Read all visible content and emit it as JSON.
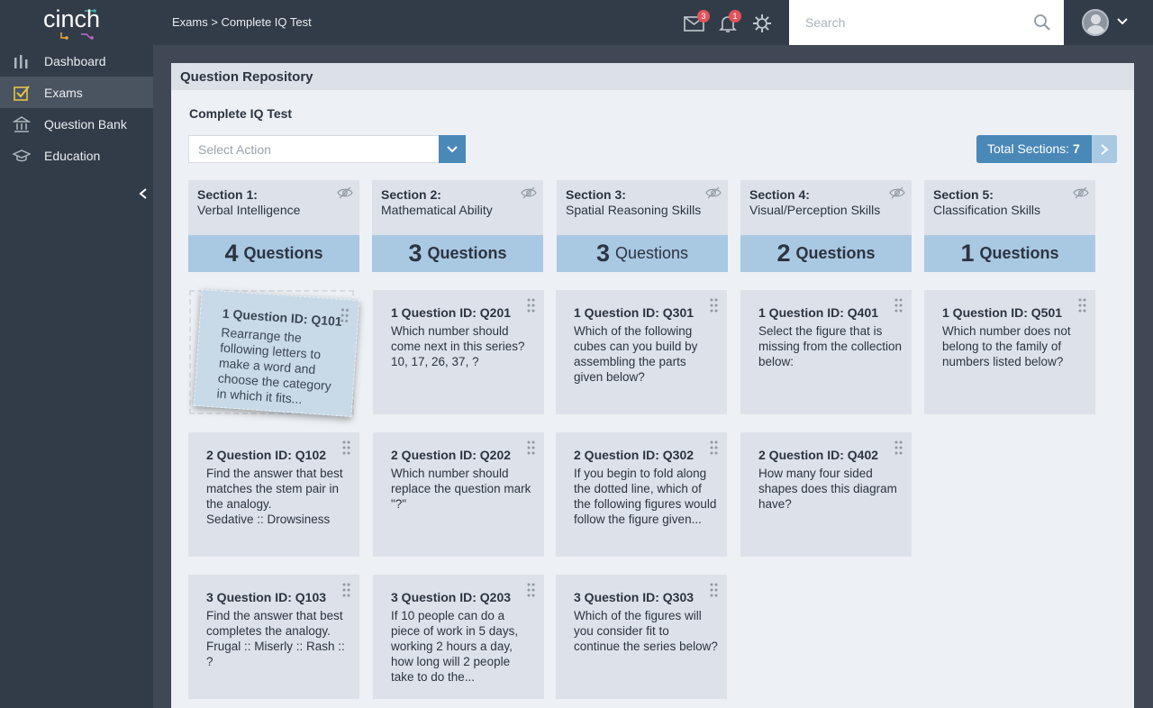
{
  "app": {
    "logo_text": "cinch"
  },
  "header": {
    "breadcrumb": "Exams > Complete IQ Test",
    "mail_count": "3",
    "notification_count": "1",
    "search_placeholder": "Search"
  },
  "sidebar": {
    "items": [
      {
        "label": "Dashboard",
        "icon": "bar-chart-icon",
        "active": false
      },
      {
        "label": "Exams",
        "icon": "checklist-icon",
        "active": true
      },
      {
        "label": "Question Bank",
        "icon": "bank-icon",
        "active": false
      },
      {
        "label": "Education",
        "icon": "graduation-cap-icon",
        "active": false
      }
    ]
  },
  "panel": {
    "title": "Question Repository",
    "test_title": "Complete IQ Test",
    "select_action": "Select Action",
    "total_label": "Total Sections: ",
    "total_value": "7"
  },
  "sections": [
    {
      "name": "Section 1:",
      "subtitle": "Verbal Intelligence",
      "count": "4",
      "label": "Questions"
    },
    {
      "name": "Section 2:",
      "subtitle": "Mathematical Ability",
      "count": "3",
      "label": "Questions"
    },
    {
      "name": "Section 3:",
      "subtitle": "Spatial Reasoning Skills",
      "count": "3",
      "label": "Questions"
    },
    {
      "name": "Section 4:",
      "subtitle": "Visual/Perception Skills",
      "count": "2",
      "label": "Questions"
    },
    {
      "name": "Section 5:",
      "subtitle": "Classification Skills",
      "count": "1",
      "label": "Questions"
    }
  ],
  "questions": {
    "q101": {
      "title": "1 Question ID: Q101",
      "text": "Rearrange the following letters to make a word and choose the category in which it fits..."
    },
    "q201": {
      "title": "1 Question ID: Q201",
      "text": "Which number should come next in this series?\n10, 17, 26, 37, ?"
    },
    "q301": {
      "title": "1 Question ID: Q301",
      "text": "Which of the following cubes can you build by assembling the parts given below?"
    },
    "q401": {
      "title": "1 Question ID: Q401",
      "text": "Select the figure that is missing from the collection below:"
    },
    "q501": {
      "title": "1 Question ID: Q501",
      "text": "Which number does not belong to the family of numbers listed below?"
    },
    "q102": {
      "title": "2 Question ID: Q102",
      "text": "Find the answer that best matches the stem pair in the analogy.\nSedative :: Drowsiness"
    },
    "q202": {
      "title": "2 Question ID: Q202",
      "text": "Which number should replace the question mark \"?\""
    },
    "q302": {
      "title": "2 Question ID: Q302",
      "text": "If you begin to fold along the dotted line, which of the following figures would follow the figure given..."
    },
    "q402": {
      "title": "2 Question ID: Q402",
      "text": "How many four sided shapes does this diagram have?"
    },
    "q103": {
      "title": "3 Question ID: Q103",
      "text": "Find the answer that best completes the analogy.\nFrugal :: Miserly :: Rash :: ?"
    },
    "q203": {
      "title": "3 Question ID: Q203",
      "text": "If 10 people can do a piece of work in 5 days, working 2 hours a day, how long will 2 people take to do the..."
    },
    "q303": {
      "title": "3 Question ID: Q303",
      "text": "Which of the figures will you consider fit to continue the series below?"
    }
  },
  "colors": {
    "accent": "#4a88b8",
    "section_band": "#a9c8e2",
    "badge": "#e0545a",
    "sidebar": "#323c48"
  }
}
